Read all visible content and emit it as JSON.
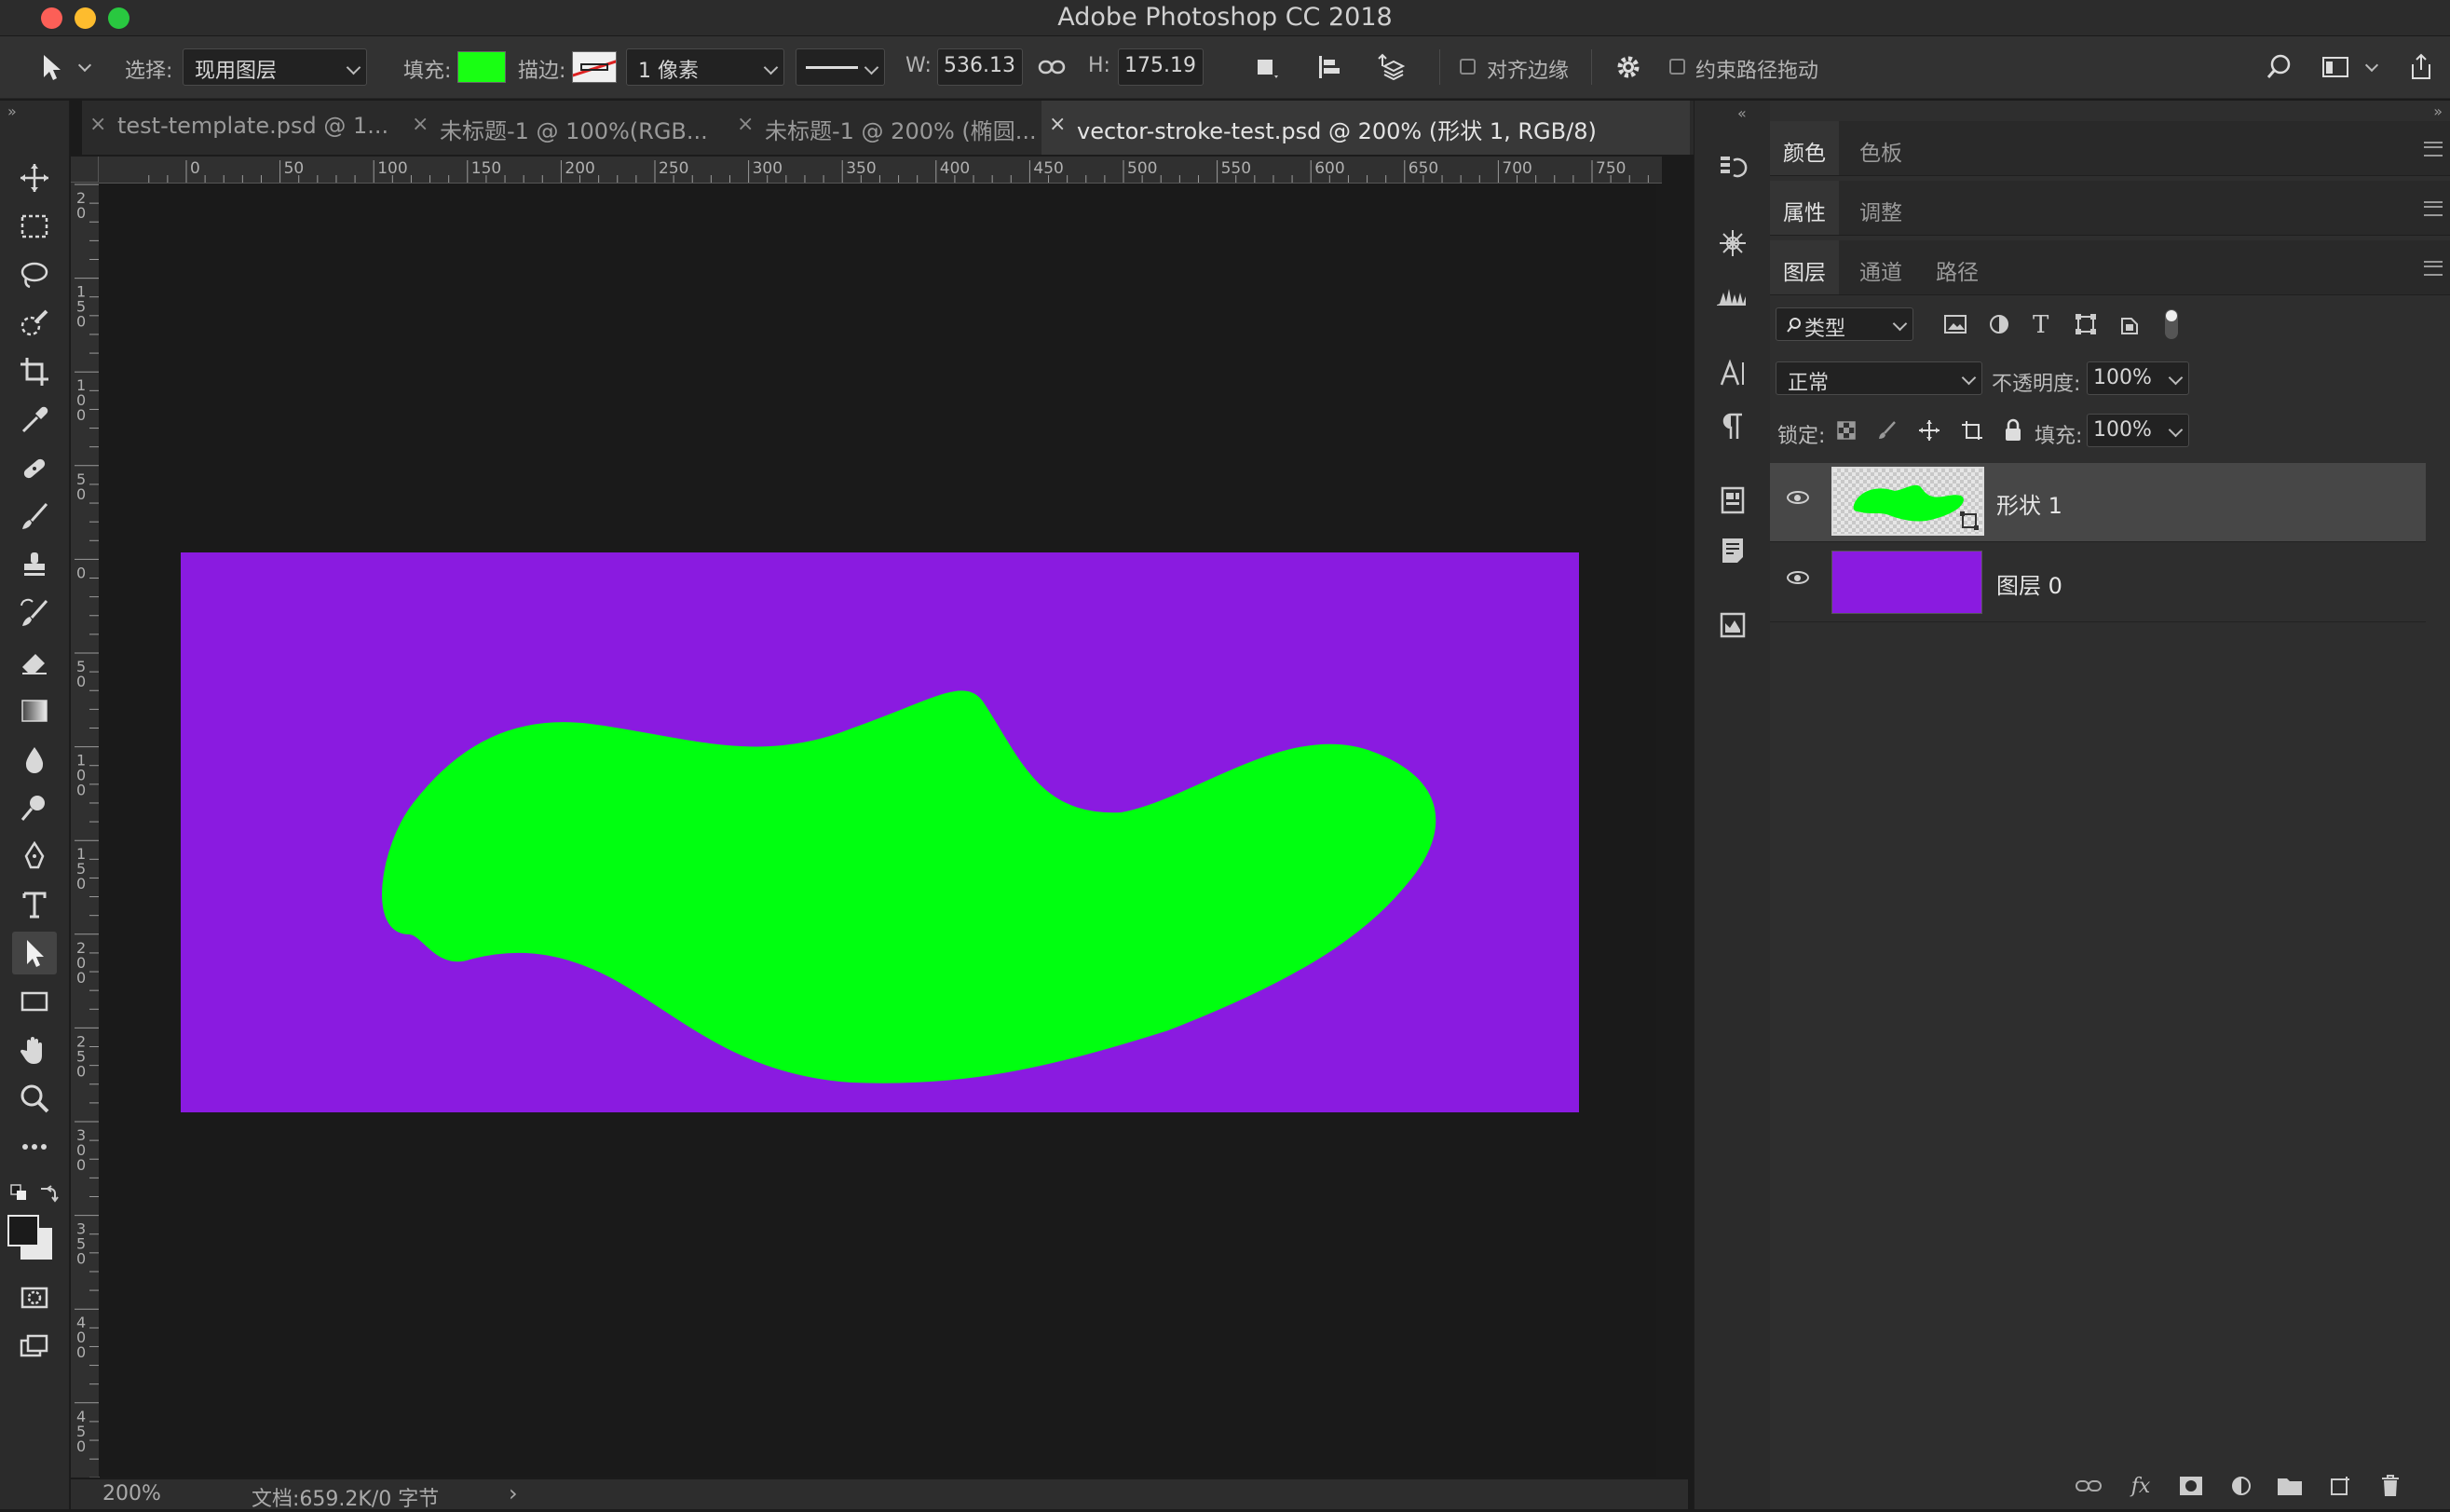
{
  "window": {
    "title": "Adobe Photoshop CC 2018",
    "traffic_lights": {
      "close": "#fc5f57",
      "minimize": "#fdbc2e",
      "zoom": "#29c840"
    }
  },
  "options_bar": {
    "tool_icon": "path-selection-arrow-icon",
    "select_label": "选择:",
    "select_value": "现用图层",
    "fill_label": "填充:",
    "fill_color": "#19ff13",
    "stroke_label": "描边:",
    "stroke_width_value": "1 像素",
    "width_label": "W:",
    "width_value": "536.13",
    "link_icon": "link-icon",
    "height_label": "H:",
    "height_value": "175.19 !",
    "align_edges_label": "对齐边缘",
    "constrain_path_label": "约束路径拖动"
  },
  "tabs": [
    {
      "label": "test-template.psd @ 1...",
      "active": false
    },
    {
      "label": "未标题-1 @ 100%(RGB...",
      "active": false
    },
    {
      "label": "未标题-1 @ 200% (椭圆...",
      "active": false
    },
    {
      "label": "vector-stroke-test.psd @ 200% (形状 1, RGB/8)",
      "active": true
    }
  ],
  "close_glyph": "×",
  "ruler_top_labels": [
    "0",
    "50",
    "100",
    "150",
    "200",
    "250",
    "300",
    "350",
    "400",
    "450",
    "500",
    "550",
    "600",
    "650",
    "700",
    "750"
  ],
  "ruler_left_labels": [
    "2\n0",
    "1\n5\n0",
    "1\n0\n0",
    "5\n0",
    "0",
    "5\n0",
    "1\n0\n0",
    "1\n5\n0",
    "2\n0\n0",
    "2\n5\n0",
    "3\n0\n0",
    "3\n5\n0",
    "4\n0\n0",
    "4\n5\n0"
  ],
  "canvas": {
    "background_color": "#8a1be0",
    "shape_color": "#00ff10"
  },
  "status": {
    "zoom": "200%",
    "doc_info": "文档:659.2K/0 字节",
    "arrow": "›"
  },
  "panels": {
    "group1": {
      "tabs": [
        "颜色",
        "色板"
      ]
    },
    "group2": {
      "tabs": [
        "属性",
        "调整"
      ]
    },
    "group3": {
      "tabs": [
        "图层",
        "通道",
        "路径"
      ]
    },
    "filter_kind": "类型",
    "blend_mode": "正常",
    "opacity_label": "不透明度:",
    "opacity_value": "100%",
    "lock_label": "锁定:",
    "fill_label": "填充:",
    "fill_value": "100%"
  },
  "layers": [
    {
      "name": "形状 1",
      "selected": true,
      "visible": true
    },
    {
      "name": "图层 0",
      "selected": false,
      "visible": true
    }
  ]
}
